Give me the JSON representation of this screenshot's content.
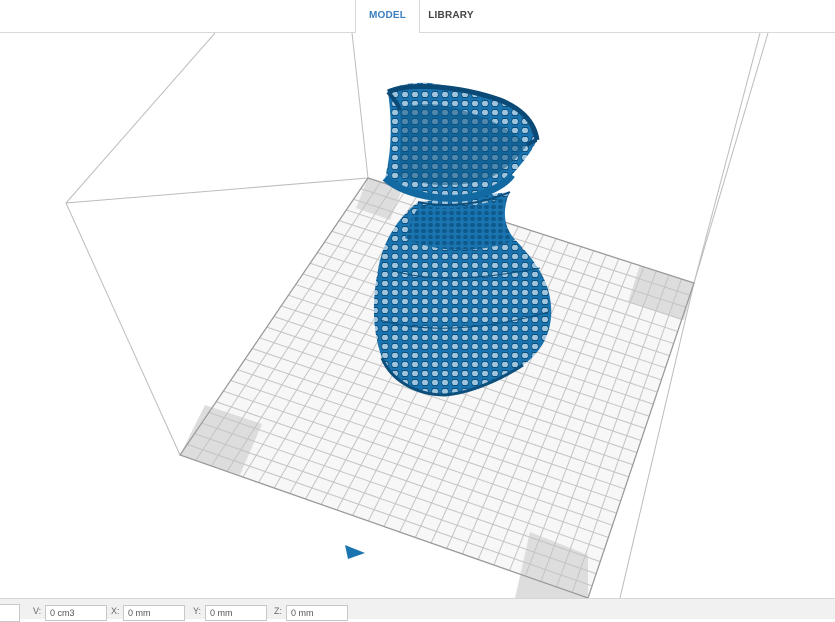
{
  "tabs": [
    {
      "label": "MODEL",
      "active": true
    },
    {
      "label": "LIBRARY",
      "active": false
    }
  ],
  "accent_color": "#3a7fc1",
  "model_color": "#1a74b0",
  "status_fields": [
    {
      "label": "V:",
      "value": "0 cm3"
    },
    {
      "label": "X:",
      "value": "0 mm"
    },
    {
      "label": "Y:",
      "value": "0 mm"
    },
    {
      "label": "Z:",
      "value": "0 mm"
    }
  ],
  "icons": [
    "front-direction-arrow-icon"
  ]
}
